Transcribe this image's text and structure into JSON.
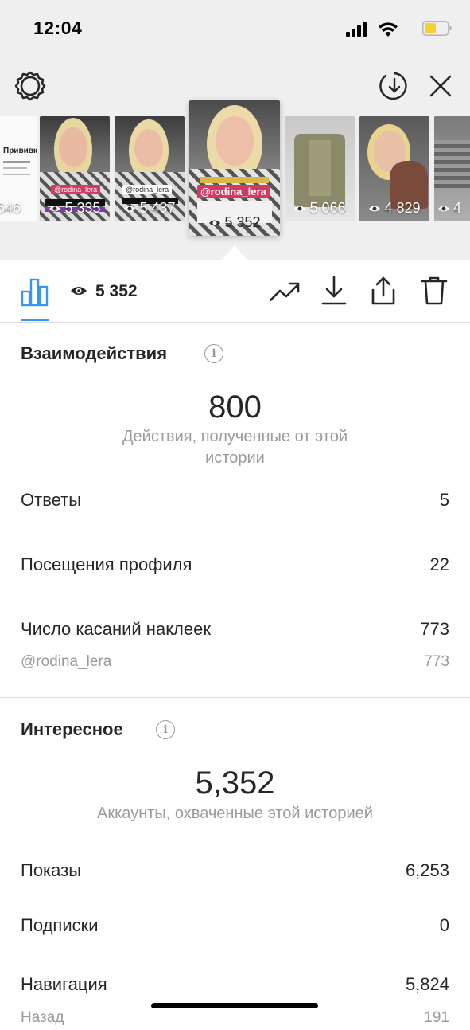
{
  "status_bar": {
    "time": "12:04"
  },
  "stories": {
    "thumbnails": [
      {
        "views": "646",
        "caption": "Прививки"
      },
      {
        "views": "5 335",
        "tag": "@rodina_lera"
      },
      {
        "views": "5 437",
        "tag": "@rodina_lera"
      },
      {
        "views": "5 352",
        "tag": "@rodina_lera",
        "selected": true
      },
      {
        "views": "5 066"
      },
      {
        "views": "4 829"
      },
      {
        "views": "4"
      }
    ]
  },
  "tabbar": {
    "views": "5 352"
  },
  "interactions": {
    "title": "Взаимодействия",
    "total": "800",
    "caption": "Действия, полученные от этой истории",
    "rows": [
      {
        "label": "Ответы",
        "value": "5"
      },
      {
        "label": "Посещения профиля",
        "value": "22"
      },
      {
        "label": "Число касаний наклеек",
        "value": "773"
      },
      {
        "label": "@rodina_lera",
        "value": "773"
      }
    ]
  },
  "discovery": {
    "title": "Интересное",
    "total": "5,352",
    "caption": "Аккаунты, охваченные этой историей",
    "rows": [
      {
        "label": "Показы",
        "value": "6,253"
      },
      {
        "label": "Подписки",
        "value": "0"
      },
      {
        "label": "Навигация",
        "value": "5,824"
      },
      {
        "label": "Назад",
        "value": "191"
      }
    ]
  },
  "colors": {
    "accent": "#3897f0",
    "tag": "#d63864"
  },
  "icons": [
    "settings-gear-icon",
    "download-circle-icon",
    "close-icon",
    "bar-chart-icon",
    "eye-icon",
    "trend-arrow-icon",
    "download-icon",
    "share-icon",
    "trash-icon",
    "info-icon"
  ]
}
